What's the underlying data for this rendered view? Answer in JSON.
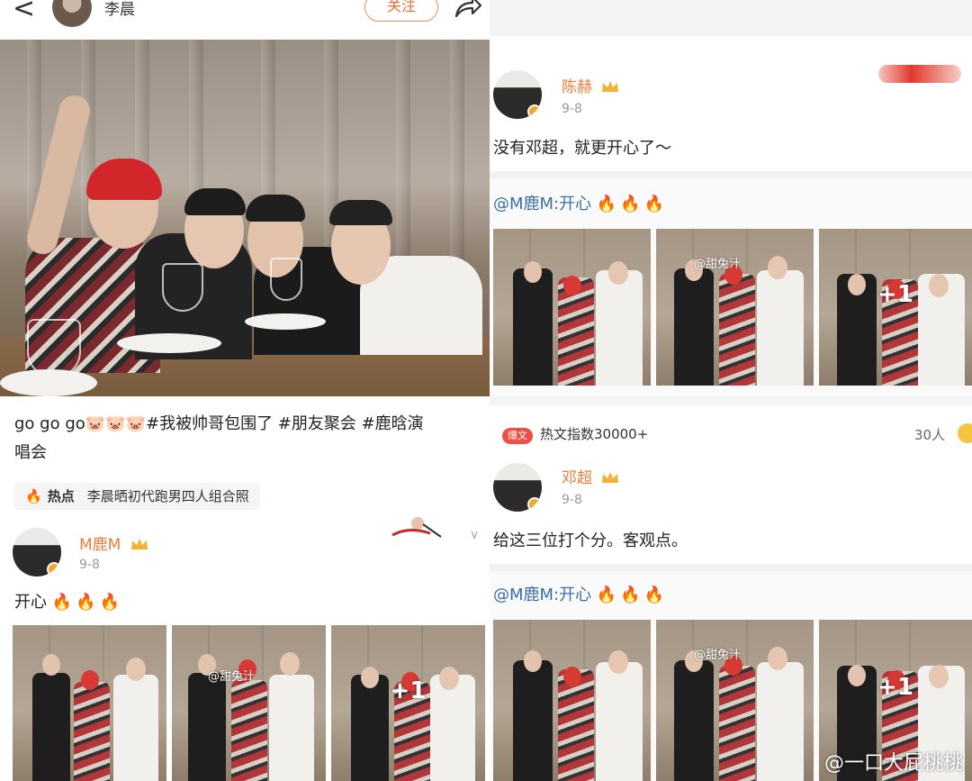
{
  "top": {
    "back": "<",
    "name": "李晨",
    "follow": "关注"
  },
  "post": {
    "text_line1": "go go go🐷🐷🐷#我被帅哥包围了 #朋友聚会 #鹿晗演",
    "text_line2": "唱会",
    "hot_label": "热点",
    "hot_text": "李晨晒初代跑男四人组合照"
  },
  "left_comment": {
    "name": "M鹿M",
    "date": "9-8",
    "text": "开心",
    "fires": "🔥🔥🔥",
    "thumbs": [
      {
        "watermark": ""
      },
      {
        "watermark": "@甜兔汁"
      },
      {
        "plus": "+1"
      }
    ]
  },
  "right": {
    "comment1": {
      "name": "陈赫",
      "date": "9-8",
      "text": "没有邓超，就更开心了～",
      "mention": "@M鹿M:开心",
      "fires": "🔥🔥🔥",
      "thumbs": [
        {
          "watermark": ""
        },
        {
          "watermark": "@甜兔汁"
        },
        {
          "plus": "+1"
        }
      ]
    },
    "hot_badge": "爆文",
    "hot_index": "热文指数30000+",
    "people_count": "30人",
    "comment2": {
      "name": "邓超",
      "date": "9-8",
      "text": "给这三位打个分。客观点。",
      "mention": "@M鹿M:开心",
      "fires": "🔥🔥🔥",
      "thumbs": [
        {
          "watermark": ""
        },
        {
          "watermark": "@甜兔汁"
        },
        {
          "plus": "+1"
        }
      ]
    },
    "footer_watermark": "@一口大屁桃桃"
  },
  "colors": {
    "accent": "#f07a3a",
    "link": "#3a6ea5",
    "hot_red": "#f04e45"
  }
}
